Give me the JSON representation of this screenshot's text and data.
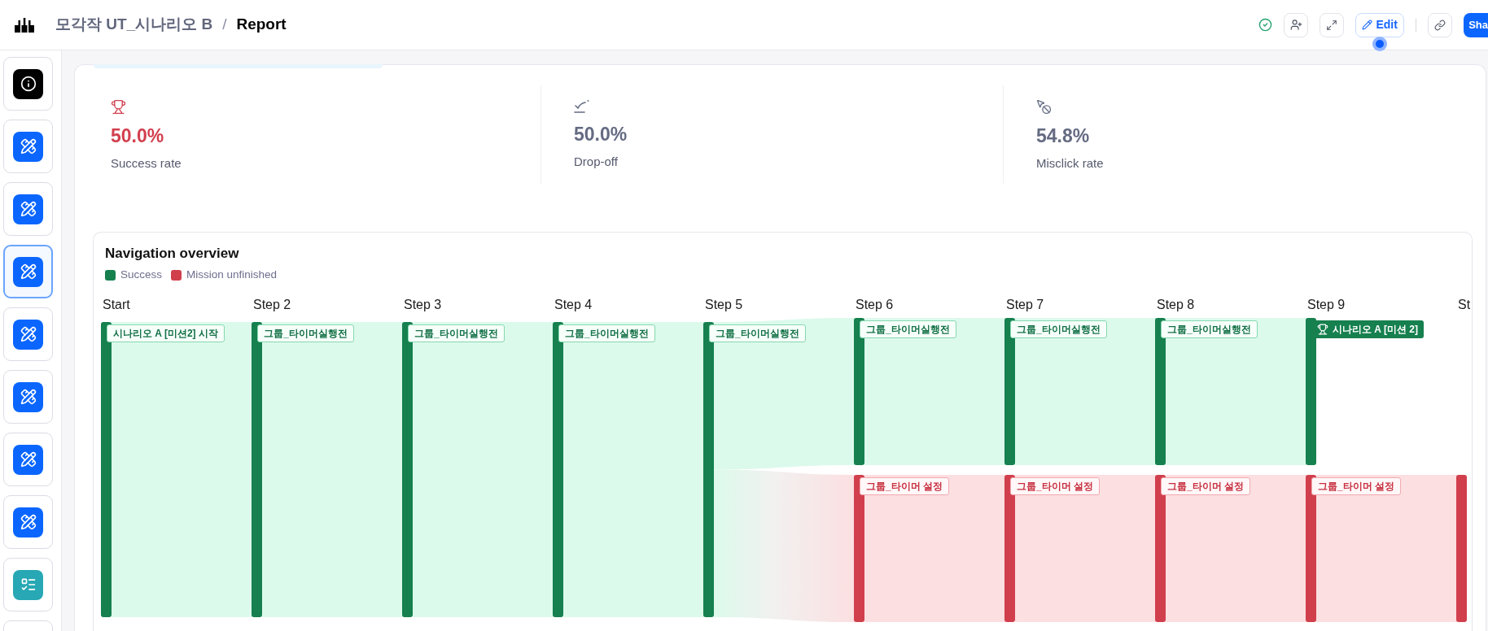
{
  "header": {
    "breadcrumb": [
      {
        "text": "모각작 UT_시나리오 B",
        "current": false
      },
      {
        "text": "Report",
        "current": true
      }
    ],
    "separator": "/",
    "toolbar": [
      {
        "kind": "status"
      },
      {
        "kind": "invite"
      },
      {
        "kind": "fullscreen"
      },
      {
        "kind": "edit",
        "label": "Edit"
      },
      {
        "kind": "divider"
      },
      {
        "kind": "link"
      },
      {
        "kind": "share",
        "label": "Sha"
      }
    ]
  },
  "sidebar": {
    "items": [
      {
        "kind": "info",
        "selected": false
      },
      {
        "kind": "task",
        "selected": false
      },
      {
        "kind": "task",
        "selected": false
      },
      {
        "kind": "task",
        "selected": true
      },
      {
        "kind": "task",
        "selected": false
      },
      {
        "kind": "task",
        "selected": false
      },
      {
        "kind": "task",
        "selected": false
      },
      {
        "kind": "task",
        "selected": false
      },
      {
        "kind": "checklist",
        "selected": false
      },
      {
        "kind": "cut_off",
        "selected": false
      }
    ]
  },
  "stats": [
    {
      "kind": "success",
      "value": "50.0%",
      "label": "Success rate",
      "color": "#d23f4e"
    },
    {
      "kind": "drop_off",
      "value": "50.0%",
      "label": "Drop-off",
      "color": "#646b82"
    },
    {
      "kind": "misclick",
      "value": "54.8%",
      "label": "Misclick rate",
      "color": "#646b82"
    }
  ],
  "navigation_overview": {
    "title": "Navigation overview",
    "legend": [
      {
        "kind": "success",
        "label": "Success",
        "color": "#16804f"
      },
      {
        "kind": "unfinished",
        "label": "Mission unfinished",
        "color": "#d13f4c"
      }
    ],
    "steps": [
      {
        "label": "Start",
        "nodes": [
          {
            "kind": "success",
            "label": "시나리오 A [미션2] 시작"
          }
        ]
      },
      {
        "label": "Step 2",
        "nodes": [
          {
            "kind": "success",
            "label": "그룹_타이머실행전"
          }
        ]
      },
      {
        "label": "Step 3",
        "nodes": [
          {
            "kind": "success",
            "label": "그룹_타이머실행전"
          }
        ]
      },
      {
        "label": "Step 4",
        "nodes": [
          {
            "kind": "success",
            "label": "그룹_타이머실행전"
          }
        ]
      },
      {
        "label": "Step 5",
        "nodes": [
          {
            "kind": "success",
            "label": "그룹_타이머실행전"
          }
        ]
      },
      {
        "label": "Step 6",
        "nodes": [
          {
            "kind": "success",
            "label": "그룹_타이머실행전"
          },
          {
            "kind": "unfinished",
            "label": "그룹_타이머 설정"
          }
        ]
      },
      {
        "label": "Step 7",
        "nodes": [
          {
            "kind": "success",
            "label": "그룹_타이머실행전"
          },
          {
            "kind": "unfinished",
            "label": "그룹_타이머 설정"
          }
        ]
      },
      {
        "label": "Step 8",
        "nodes": [
          {
            "kind": "success",
            "label": "그룹_타이머실행전"
          },
          {
            "kind": "unfinished",
            "label": "그룹_타이머 설정"
          }
        ]
      },
      {
        "label": "Step 9",
        "nodes": [
          {
            "kind": "goal",
            "label": "시나리오 A [미션 2]"
          },
          {
            "kind": "unfinished",
            "label": "그룹_타이머 설정"
          }
        ]
      },
      {
        "label": "St",
        "nodes": [
          {
            "kind": "unfinished"
          }
        ]
      }
    ]
  }
}
